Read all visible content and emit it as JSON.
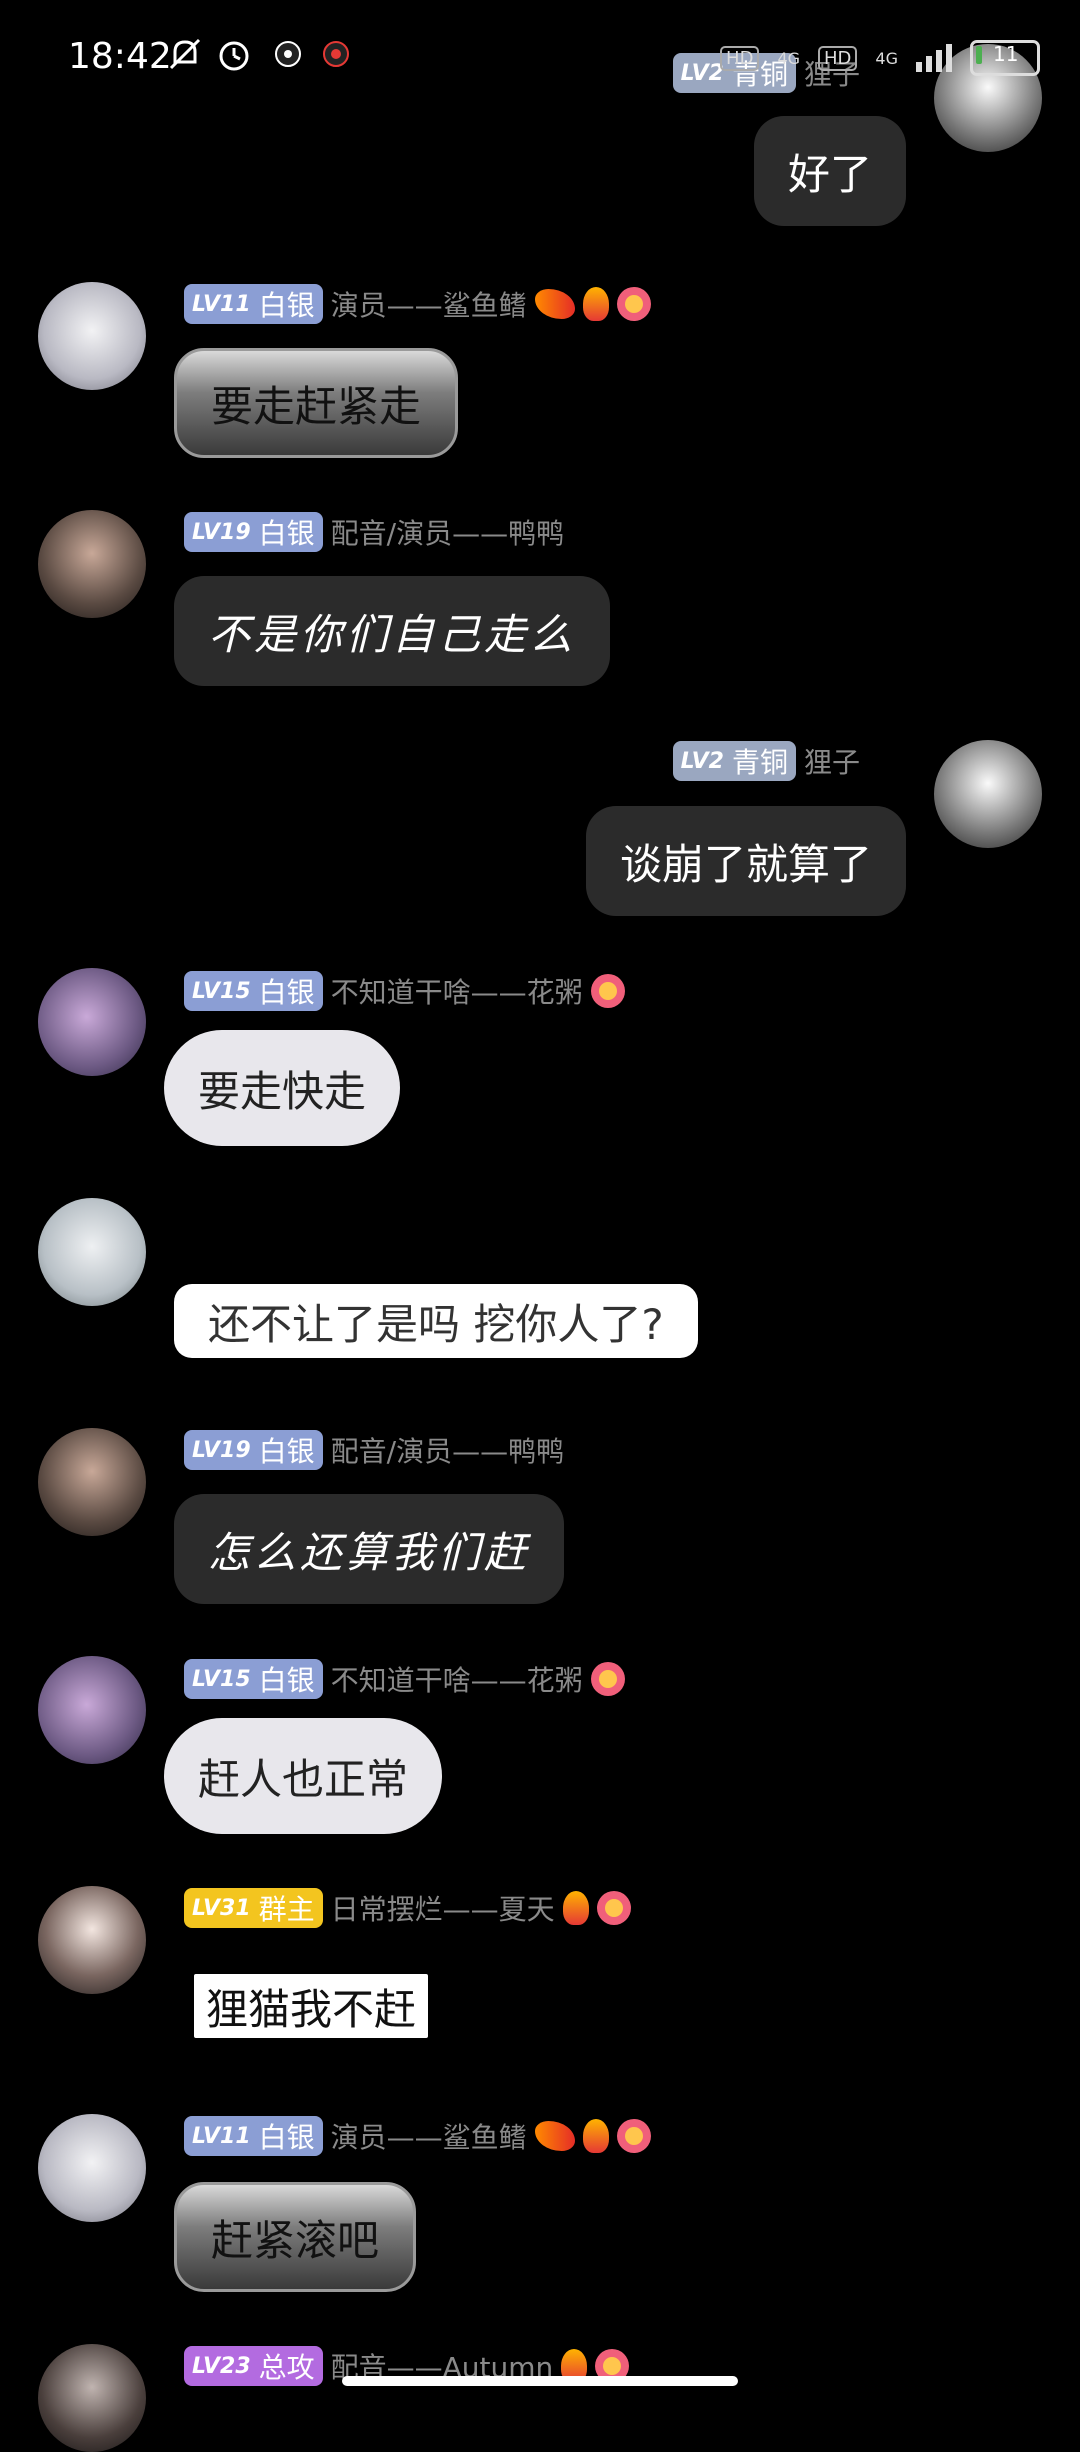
{
  "status_bar": {
    "time": "18:42",
    "net1": "HD",
    "net1_type": "4G",
    "net2": "HD",
    "net2_type": "4G",
    "battery": "11"
  },
  "messages": [
    {
      "id": "m0",
      "side": "right",
      "level": "LV2",
      "rank": "青铜",
      "nick": "狸子",
      "text": "好了"
    },
    {
      "id": "m1",
      "side": "left",
      "level": "LV11",
      "rank": "白银",
      "nick": "演员——鲨鱼鳍",
      "text": "要走赶紧走"
    },
    {
      "id": "m2",
      "side": "left",
      "level": "LV19",
      "rank": "白银",
      "nick": "配音/演员——鸭鸭",
      "text": "不是你们自己走么"
    },
    {
      "id": "m3",
      "side": "right",
      "level": "LV2",
      "rank": "青铜",
      "nick": "狸子",
      "text": "谈崩了就算了"
    },
    {
      "id": "m4",
      "side": "left",
      "level": "LV15",
      "rank": "白银",
      "nick": "不知道干啥——花粥",
      "text": "要走快走"
    },
    {
      "id": "m5",
      "side": "left",
      "text": "还不让了是吗 挖你人了?"
    },
    {
      "id": "m6",
      "side": "left",
      "level": "LV19",
      "rank": "白银",
      "nick": "配音/演员——鸭鸭",
      "text": "怎么还算我们赶"
    },
    {
      "id": "m7",
      "side": "left",
      "level": "LV15",
      "rank": "白银",
      "nick": "不知道干啥——花粥",
      "text": "赶人也正常"
    },
    {
      "id": "m8",
      "side": "left",
      "level": "LV31",
      "rank": "群主",
      "nick": "日常摆烂——夏天",
      "text": "狸猫我不赶"
    },
    {
      "id": "m9",
      "side": "left",
      "level": "LV11",
      "rank": "白银",
      "nick": "演员——鲨鱼鳍",
      "text": "赶紧滚吧"
    },
    {
      "id": "m10",
      "side": "left",
      "level": "LV23",
      "rank": "总攻",
      "nick": "配音——Autumn"
    }
  ]
}
